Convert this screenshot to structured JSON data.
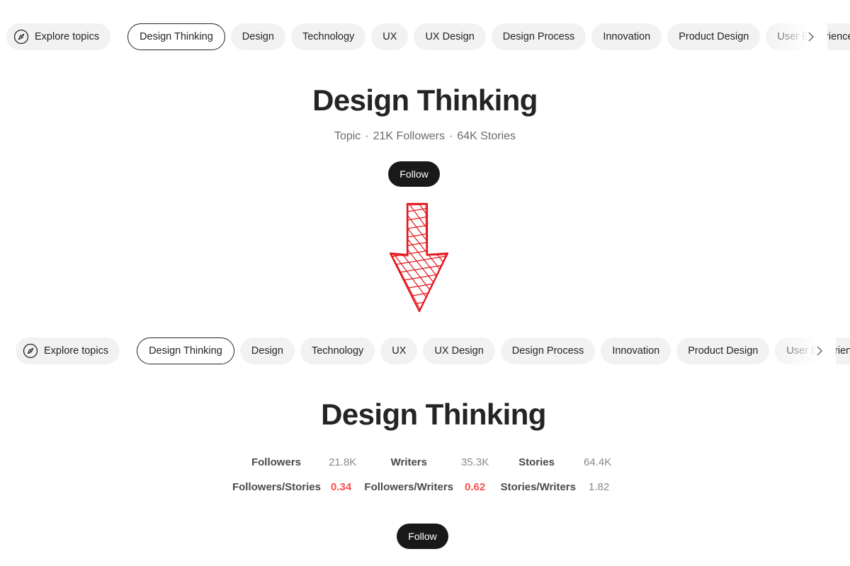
{
  "top": {
    "topics_bar": {
      "explore_label": "Explore topics",
      "topics": [
        "Design Thinking",
        "Design",
        "Technology",
        "UX",
        "UX Design",
        "Design Process",
        "Innovation",
        "Product Design",
        "User Experience"
      ],
      "active_topic": "Design Thinking"
    },
    "title": "Design Thinking",
    "meta": {
      "type": "Topic",
      "followers": "21K Followers",
      "stories": "64K Stories",
      "separator": "·"
    },
    "follow_label": "Follow"
  },
  "bottom": {
    "topics_bar": {
      "explore_label": "Explore topics",
      "topics": [
        "Design Thinking",
        "Design",
        "Technology",
        "UX",
        "UX Design",
        "Design Process",
        "Innovation",
        "Product Design",
        "User Experience"
      ],
      "active_topic": "Design Thinking"
    },
    "title": "Design Thinking",
    "stats_row1": [
      {
        "label": "Followers",
        "value": "21.8K"
      },
      {
        "label": "Writers",
        "value": "35.3K"
      },
      {
        "label": "Stories",
        "value": "64.4K"
      }
    ],
    "stats_row2": [
      {
        "label": "Followers/Stories",
        "value": "0.34",
        "highlight": true
      },
      {
        "label": "Followers/Writers",
        "value": "0.62",
        "highlight": true
      },
      {
        "label": "Stories/Writers",
        "value": "1.82",
        "highlight": false
      }
    ],
    "follow_label": "Follow"
  },
  "colors": {
    "text": "#242424",
    "pill_bg": "#f2f2f2",
    "follow_bg": "#191919",
    "highlight_value": "#ff4d4d",
    "arrow": "#e3141b"
  },
  "icons": {
    "explore": "compass-icon",
    "scroll": "chevron-right-icon",
    "annotation": "down-arrow-icon"
  }
}
